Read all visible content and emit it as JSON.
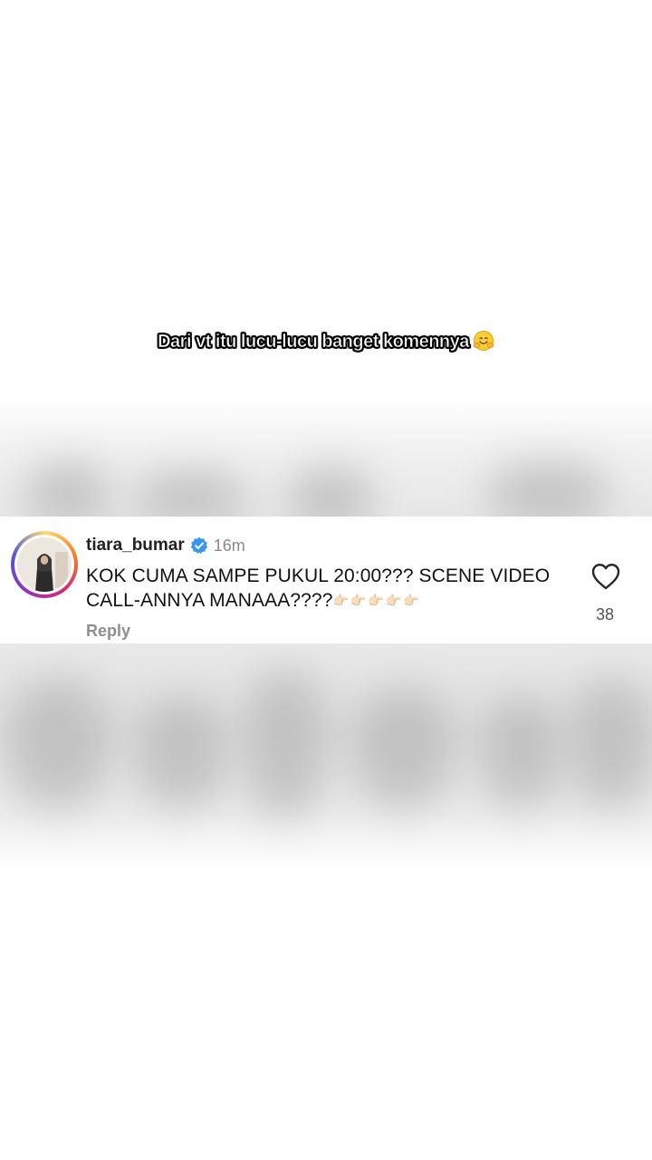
{
  "caption": {
    "text": "Dari vt itu lucu-lucu banget komennya",
    "emoji": "hugging-face"
  },
  "comment": {
    "username": "tiara_bumar",
    "verified": true,
    "time_ago": "16m",
    "text": "KOK CUMA SAMPE PUKUL 20:00??? SCENE VIDEO CALL-ANNYA MANAAA????",
    "trailing_emoji": "👉🏻👉🏻👉🏻👉🏻👉🏻",
    "reply_label": "Reply",
    "like_count": "38"
  },
  "colors": {
    "verified_badge": "#3897f0",
    "username": "#222222",
    "muted": "#8e8e8e"
  }
}
